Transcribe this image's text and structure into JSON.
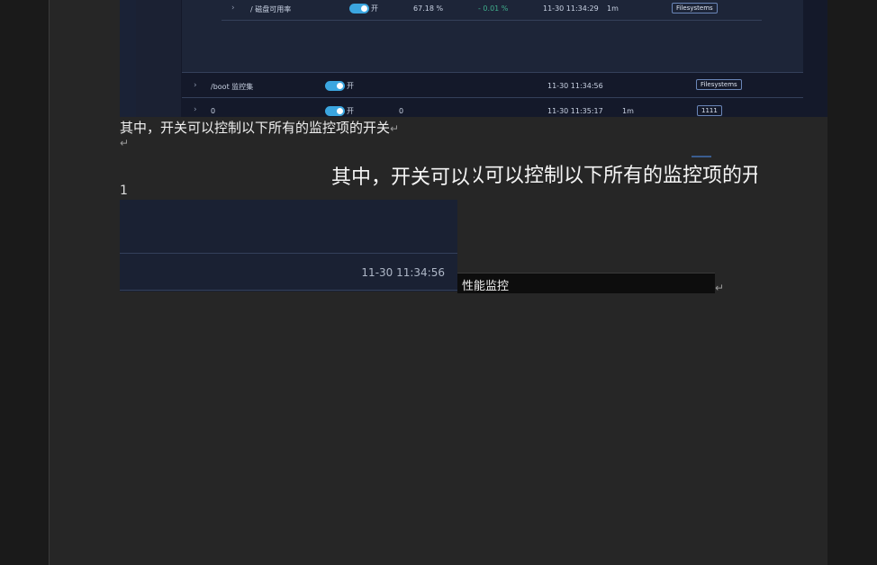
{
  "embedded_table": {
    "row1": {
      "expander": "›",
      "name": "/ 磁盘可用率",
      "toggle_label": "开",
      "value": "67.18 %",
      "delta": "- 0.01 %",
      "time": "11-30 11:34:29",
      "interval": "1m",
      "tag": "Filesystems"
    },
    "row2": {
      "expander": "›",
      "name": "/boot 监控集",
      "toggle_label": "开",
      "time": "11-30 11:34:56",
      "tag": "Filesystems"
    },
    "row3": {
      "expander": "›",
      "name": "0",
      "toggle_label": "开",
      "value": "0",
      "time": "11-30 11:35:17",
      "interval": "1m",
      "tag": "1111"
    }
  },
  "document": {
    "paragraph": "其中，开关可以控制以下所有的监控项的开关",
    "return_mark": "↵",
    "big_left": "其中，开关可以",
    "big_right": "以可以控制以下所有的监控项的开",
    "number": "1",
    "image_timestamp": "11-30 11:34:56",
    "bar_label": "性能监控"
  }
}
